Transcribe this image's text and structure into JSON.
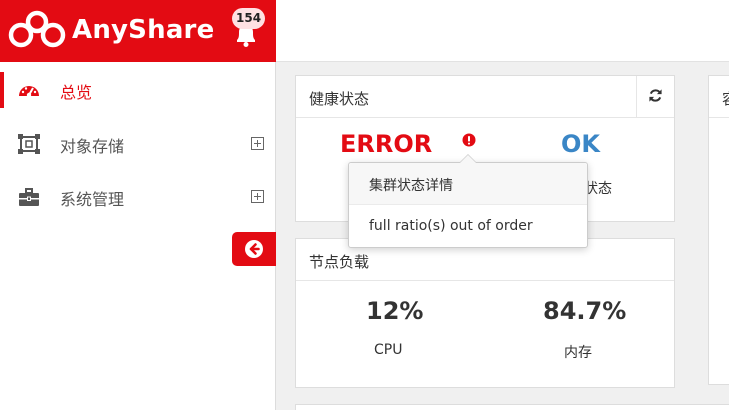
{
  "header": {
    "brand": "AnyShare",
    "notifications_count": "154"
  },
  "sidebar": {
    "items": [
      {
        "label": "总览",
        "icon": "dashboard-icon",
        "active": true
      },
      {
        "label": "对象存储",
        "icon": "object-storage-icon",
        "active": false
      },
      {
        "label": "系统管理",
        "icon": "briefcase-icon",
        "active": false
      }
    ]
  },
  "panels": {
    "health": {
      "title": "健康状态",
      "status_error": "ERROR",
      "status_ok": "OK",
      "partial_label": "状态"
    },
    "node_load": {
      "title": "节点负载",
      "metrics": [
        {
          "value": "12%",
          "label": "CPU"
        },
        {
          "value": "84.7%",
          "label": "内存"
        }
      ]
    },
    "third": {
      "title_partial": "容"
    }
  },
  "popover": {
    "title": "集群状态详情",
    "body": "full ratio(s) out of order"
  },
  "colors": {
    "brand_red": "#e30b13",
    "ok_blue": "#3a86c6"
  }
}
